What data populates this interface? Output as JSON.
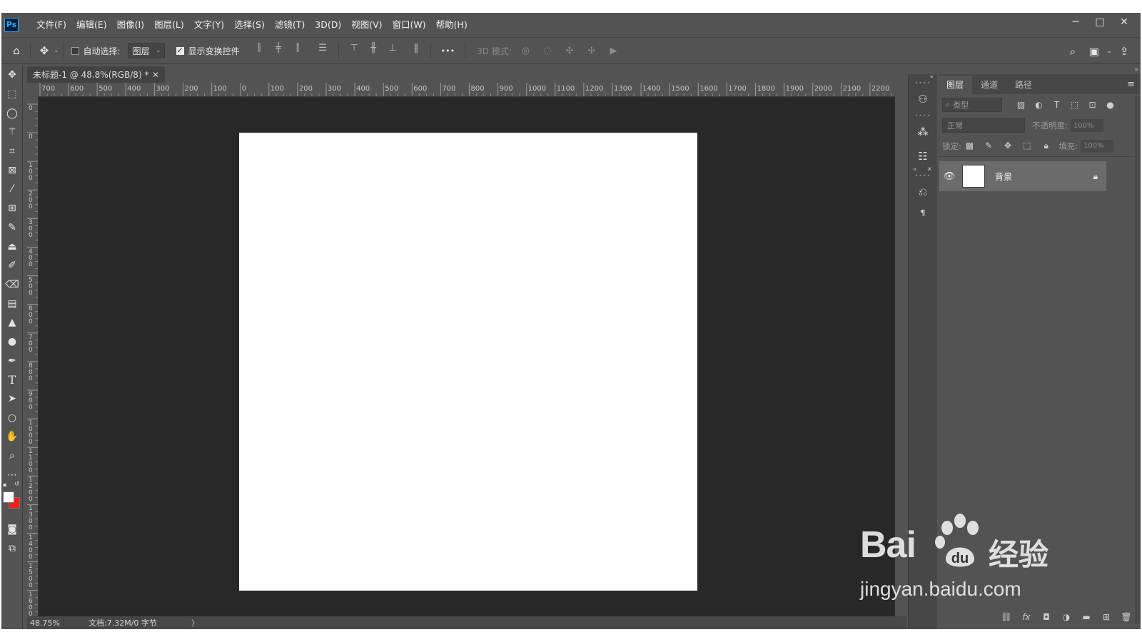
{
  "app": {
    "logo": "Ps"
  },
  "menu": {
    "items": [
      "文件(F)",
      "编辑(E)",
      "图像(I)",
      "图层(L)",
      "文字(Y)",
      "选择(S)",
      "滤镜(T)",
      "3D(D)",
      "视图(V)",
      "窗口(W)",
      "帮助(H)"
    ]
  },
  "window_controls": {
    "minimize": "─",
    "maximize": "□",
    "close": "✕"
  },
  "options": {
    "home_icon": "home-icon",
    "move_icon": "move-tool-icon",
    "auto_select_label": "自动选择:",
    "auto_select_checked": false,
    "auto_select_target": "图层",
    "show_transform_label": "显示变换控件",
    "show_transform_checked": true,
    "more": "•••",
    "mode_3d_label": "3D 模式:"
  },
  "document": {
    "tab_title": "未标题-1 @ 48.8%(RGB/8) *",
    "tab_close": "✕",
    "zoom": "48.75%",
    "doc_info": "文档:7.32M/0 字节",
    "status_arrow": "〉"
  },
  "ruler": {
    "h_labels": [
      "700",
      "600",
      "500",
      "400",
      "300",
      "200",
      "100",
      "0",
      "100",
      "200",
      "300",
      "400",
      "500",
      "600",
      "700",
      "800",
      "900",
      "1000",
      "1100",
      "1200",
      "1300",
      "1400",
      "1500",
      "1600",
      "1700",
      "1800",
      "1900",
      "2000",
      "2100",
      "2200"
    ],
    "v_labels": [
      "0",
      "0",
      "1 0 0",
      "2 0 0",
      "3 0 0",
      "4 0 0",
      "5 0 0",
      "6 0 0",
      "7 0 0",
      "8 0 0",
      "9 0 0",
      "1 0 0 0",
      "1 1 0 0",
      "1 2 0 0",
      "1 3 0 0",
      "1 4 0 0",
      "1 5 0 0",
      "1 6 0 0"
    ]
  },
  "colors": {
    "foreground": "#ffffff",
    "background": "#ff1a1a",
    "ui_dark": "#535353",
    "canvas_bg": "#282828"
  },
  "layers_panel": {
    "tabs": [
      "图层",
      "通道",
      "路径"
    ],
    "active_tab": "图层",
    "filter_label": "类型",
    "blend_mode": "正常",
    "opacity_label": "不透明度:",
    "opacity_value": "100%",
    "lock_label": "锁定:",
    "fill_label": "填充:",
    "fill_value": "100%",
    "layers": [
      {
        "name": "背景",
        "visible": true,
        "locked": true
      }
    ]
  },
  "watermark": {
    "brand": "Bai",
    "brand_cn": "经验",
    "url": "jingyan.baidu.com"
  }
}
